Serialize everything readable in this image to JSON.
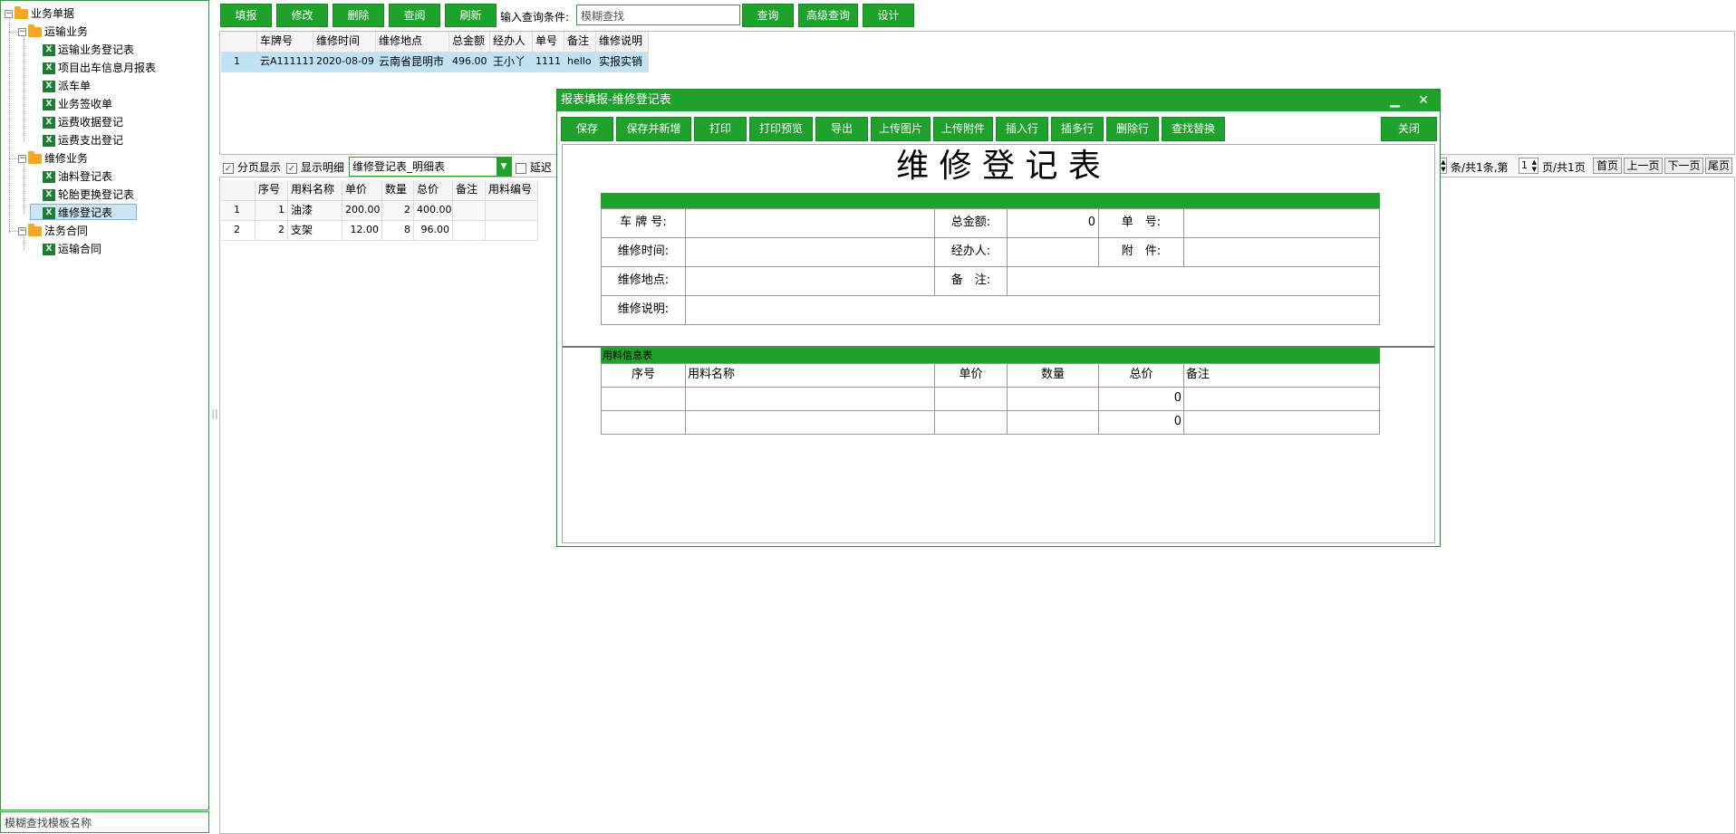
{
  "tree": {
    "root": "业务单据",
    "groups": [
      {
        "label": "运输业务",
        "items": [
          "运输业务登记表",
          "项目出车信息月报表",
          "派车单",
          "业务签收单",
          "运费收据登记",
          "运费支出登记"
        ]
      },
      {
        "label": "维修业务",
        "items": [
          "油料登记表",
          "轮胎更换登记表",
          "维修登记表"
        ]
      },
      {
        "label": "法务合同",
        "items": [
          "运输合同"
        ]
      }
    ],
    "selected": "维修登记表",
    "search_placeholder": "模糊查找模板名称"
  },
  "toolbar": {
    "buttons": [
      "填报",
      "修改",
      "删除",
      "查阅",
      "刷新"
    ],
    "query_label": "输入查询条件:",
    "query_placeholder": "模糊查找",
    "right_buttons": [
      "查询",
      "高级查询",
      "设计"
    ]
  },
  "main_grid": {
    "columns": [
      "车牌号",
      "维修时间",
      "维修地点",
      "总金额",
      "经办人",
      "单号",
      "备注",
      "维修说明"
    ],
    "rows": [
      {
        "index": "1",
        "cells": [
          "云A111111",
          "2020-08-09",
          "云南省昆明市",
          "496.00",
          "王小丫",
          "1111",
          "hello",
          "实报实销"
        ]
      }
    ]
  },
  "detail_bar": {
    "paging_label": "分页显示",
    "show_detail_label": "显示明细",
    "detail_select": "维修登记表_明细表",
    "delay_label": "延迟",
    "pager": {
      "per_page_suffix": "条/共",
      "total_records": "1",
      "records_suffix": "条,第",
      "current_page": "1",
      "pages_suffix": "页/共",
      "total_pages": "1",
      "page_unit": "页",
      "buttons": [
        "首页",
        "上一页",
        "下一页",
        "尾页"
      ]
    }
  },
  "detail_grid": {
    "columns": [
      "序号",
      "用料名称",
      "单价",
      "数量",
      "总价",
      "备注",
      "用料编号"
    ],
    "rows": [
      {
        "index": "1",
        "cells": [
          "1",
          "油漆",
          "200.00",
          "2",
          "400.00",
          "",
          ""
        ]
      },
      {
        "index": "2",
        "cells": [
          "2",
          "支架",
          "12.00",
          "8",
          "96.00",
          "",
          ""
        ]
      }
    ]
  },
  "dialog": {
    "title": "报表填报-维修登记表",
    "buttons": [
      "保存",
      "保存并新增",
      "打印",
      "打印预览",
      "导出",
      "上传图片",
      "上传附件",
      "插入行",
      "插多行",
      "删除行",
      "查找替换"
    ],
    "close_label": "关闭",
    "form_title": "维 修 登 记 表",
    "fields": {
      "plate_label": "车 牌 号:",
      "total_label": "总金额:",
      "total_value": "0",
      "number_label": "单　号:",
      "time_label": "维修时间:",
      "handler_label": "经办人:",
      "attach_label": "附　件:",
      "place_label": "维修地点:",
      "remark_label": "备　注:",
      "desc_label": "维修说明:"
    },
    "material_section": "用料信息表",
    "material_columns": [
      "序号",
      "用料名称",
      "单价",
      "数量",
      "总价",
      "备注"
    ],
    "material_rows": [
      {
        "total": "0"
      },
      {
        "total": "0"
      }
    ]
  }
}
